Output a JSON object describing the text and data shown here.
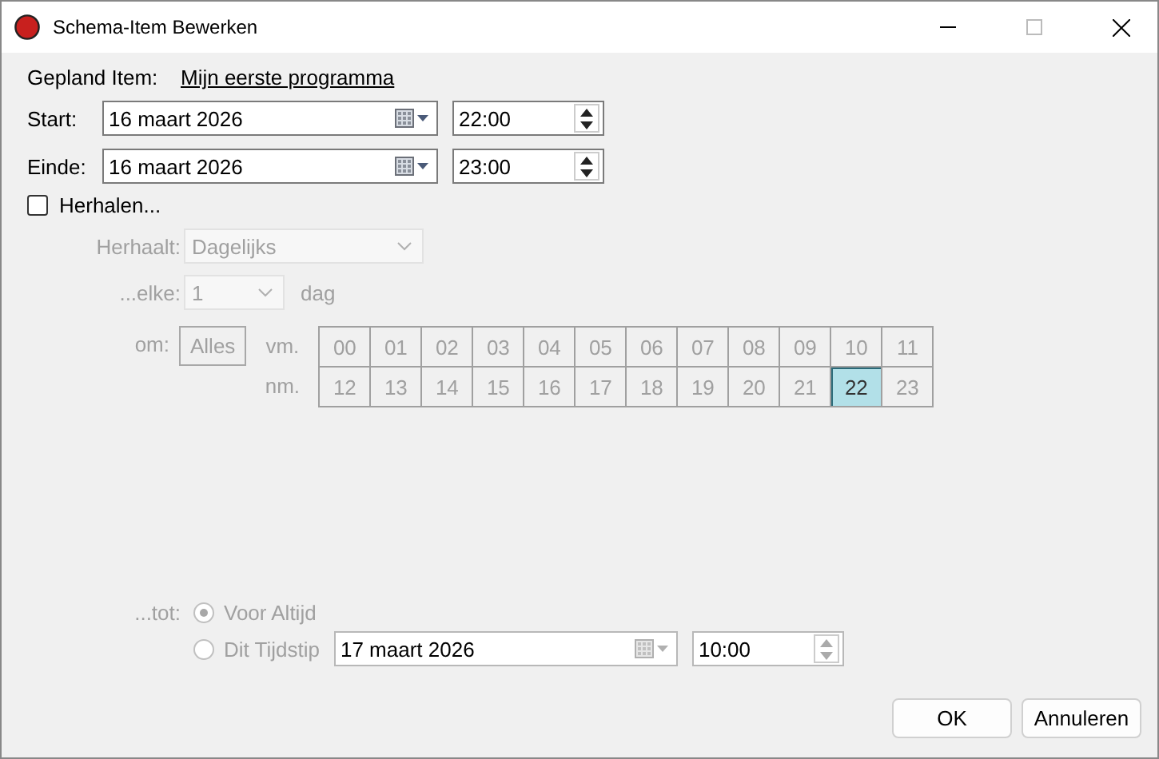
{
  "window": {
    "title": "Schema-Item Bewerken"
  },
  "scheduled_item": {
    "label": "Gepland Item:",
    "value": "Mijn eerste programma"
  },
  "start": {
    "label": "Start:",
    "date": "16 maart 2026",
    "time": "22:00"
  },
  "end": {
    "label": "Einde:",
    "date": "16 maart 2026",
    "time": "23:00"
  },
  "repeat": {
    "label": "Herhalen...",
    "checked": false
  },
  "repeats": {
    "label": "Herhaalt:",
    "value": "Dagelijks"
  },
  "every": {
    "label": "...elke:",
    "value": "1",
    "unit": "dag"
  },
  "at": {
    "label": "om:",
    "all_button": "Alles",
    "am_label": "vm.",
    "pm_label": "nm.",
    "hours": [
      {
        "label": "00",
        "selected": false
      },
      {
        "label": "01",
        "selected": false
      },
      {
        "label": "02",
        "selected": false
      },
      {
        "label": "03",
        "selected": false
      },
      {
        "label": "04",
        "selected": false
      },
      {
        "label": "05",
        "selected": false
      },
      {
        "label": "06",
        "selected": false
      },
      {
        "label": "07",
        "selected": false
      },
      {
        "label": "08",
        "selected": false
      },
      {
        "label": "09",
        "selected": false
      },
      {
        "label": "10",
        "selected": false
      },
      {
        "label": "11",
        "selected": false
      },
      {
        "label": "12",
        "selected": false
      },
      {
        "label": "13",
        "selected": false
      },
      {
        "label": "14",
        "selected": false
      },
      {
        "label": "15",
        "selected": false
      },
      {
        "label": "16",
        "selected": false
      },
      {
        "label": "17",
        "selected": false
      },
      {
        "label": "18",
        "selected": false
      },
      {
        "label": "19",
        "selected": false
      },
      {
        "label": "20",
        "selected": false
      },
      {
        "label": "21",
        "selected": false
      },
      {
        "label": "22",
        "selected": true
      },
      {
        "label": "23",
        "selected": false
      }
    ]
  },
  "until": {
    "label": "...tot:",
    "options": [
      {
        "label": "Voor Altijd",
        "selected": true
      },
      {
        "label": "Dit Tijdstip",
        "selected": false
      }
    ],
    "date": "17 maart 2026",
    "time": "10:00"
  },
  "buttons": [
    "OK",
    "Annuleren"
  ]
}
